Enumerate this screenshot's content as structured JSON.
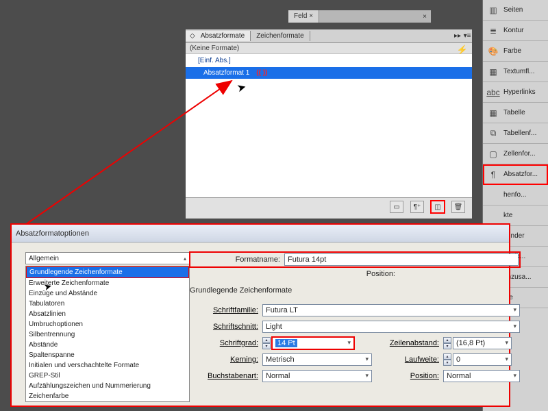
{
  "doc_tabs": {
    "tab1": "Feld ×"
  },
  "right_panels": {
    "seiten": "Seiten",
    "kontur": "Kontur",
    "farbe": "Farbe",
    "textumfl": "Textumfl...",
    "hyperlinks": "Hyperlinks",
    "tabelle": "Tabelle",
    "tabellenf": "Tabellenf...",
    "zellenfor": "Zellenfor...",
    "absatzfor": "Absatzfor...",
    "henfo": "henfo...",
    "kte": "kte",
    "nfinder": "nfinder",
    "ptetik": "ptetik...",
    "enzusa": "enzusa...",
    "pte": "pte"
  },
  "panel": {
    "tab1": "Absatzformate",
    "tab2": "Zeichenformate",
    "subtitle": "(Keine Formate)",
    "row0": "[Einf. Abs.]",
    "row_sel": "Absatzformat 1",
    "row_note": "((   ))"
  },
  "dialog": {
    "title": "Absatzformatoptionen",
    "combo_value": "Allgemein",
    "categories": [
      "Grundlegende Zeichenformate",
      "Erweiterte Zeichenformate",
      "Einzüge und Abstände",
      "Tabulatoren",
      "Absatzlinien",
      "Umbruchoptionen",
      "Silbentrennung",
      "Abstände",
      "Spaltenspanne",
      "Initialen und verschachtelte Formate",
      "GREP-Stil",
      "Aufzählungszeichen und Nummerierung",
      "Zeichenfarbe"
    ],
    "formatname_label": "Formatname:",
    "formatname_value": "Futura 14pt",
    "position_label": "Position:",
    "heading": "Grundlegende Zeichenformate",
    "f_family_label": "Schriftfamilie:",
    "f_family_value": "Futura LT",
    "f_style_label": "Schriftschnitt:",
    "f_style_value": "Light",
    "f_size_label": "Schriftgrad:",
    "f_size_value": "14 Pt",
    "f_leading_label": "Zeilenabstand:",
    "f_leading_value": "(16,8 Pt)",
    "f_kerning_label": "Kerning:",
    "f_kerning_value": "Metrisch",
    "f_tracking_label": "Laufweite:",
    "f_tracking_value": "0",
    "f_case_label": "Buchstabenart:",
    "f_case_value": "Normal",
    "f_position_label": "Position:",
    "f_position_value": "Normal"
  }
}
